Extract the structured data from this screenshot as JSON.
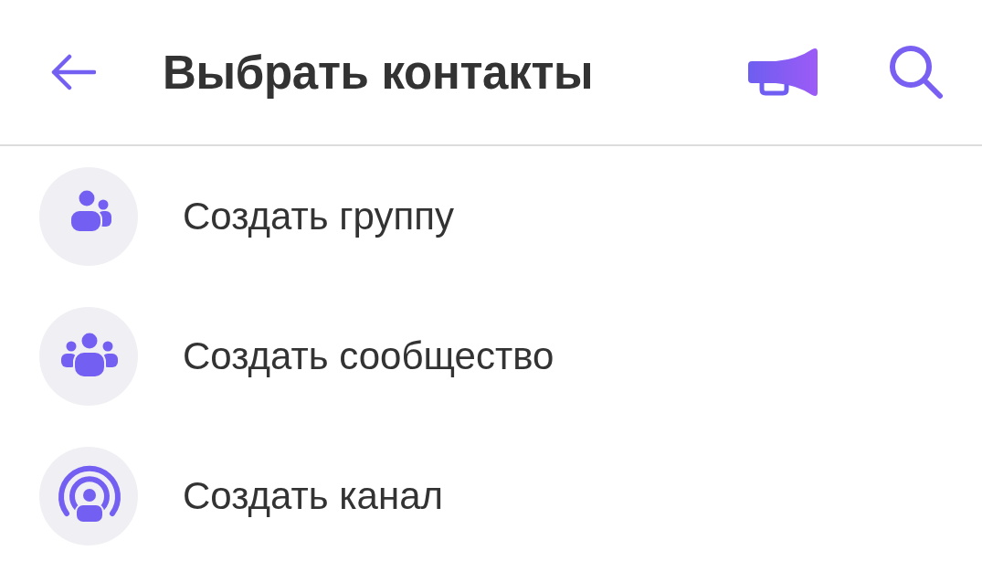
{
  "header": {
    "title": "Выбрать контакты"
  },
  "actions": [
    {
      "label": "Создать группу",
      "kind": "group"
    },
    {
      "label": "Создать сообщество",
      "kind": "community"
    },
    {
      "label": "Создать канал",
      "kind": "channel"
    }
  ]
}
